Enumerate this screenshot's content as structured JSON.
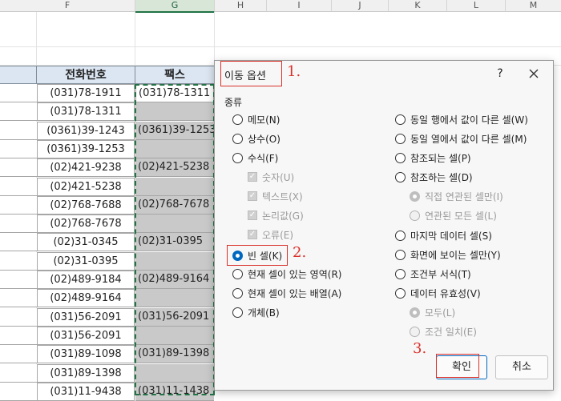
{
  "columns": [
    "F",
    "G",
    "H",
    "I",
    "J",
    "K",
    "L",
    "M"
  ],
  "sheet": {
    "header_phone": "전화번호",
    "header_fax": "팩스",
    "phones": [
      "(031)78-1911",
      "(031)78-1311",
      "(0361)39-1243",
      "(0361)39-1253",
      "(02)421-9238",
      "(02)421-5238",
      "(02)768-7688",
      "(02)768-7678",
      "(02)31-0345",
      "(02)31-0395",
      "(02)489-9184",
      "(02)489-9164",
      "(031)56-2091",
      "(031)56-2091",
      "(031)89-1098",
      "(031)89-1398",
      "(031)11-9438"
    ],
    "faxes": [
      "(031)78-1311",
      "",
      "(0361)39-1253",
      "",
      "(02)421-5238",
      "",
      "(02)768-7678",
      "",
      "(02)31-0395",
      "",
      "(02)489-9164",
      "",
      "(031)56-2091",
      "",
      "(031)89-1398",
      "",
      "(031)11-1438"
    ]
  },
  "dialog": {
    "title": "이동 옵션",
    "help": "?",
    "group_label": "종류",
    "left_options": [
      {
        "label": "메모(N)"
      },
      {
        "label": "상수(O)"
      },
      {
        "label": "수식(F)"
      },
      {
        "label": "숫자(U)"
      },
      {
        "label": "텍스트(X)"
      },
      {
        "label": "논리값(G)"
      },
      {
        "label": "오류(E)"
      },
      {
        "label": "빈 셀(K)",
        "checked": true
      },
      {
        "label": "현재 셀이 있는 영역(R)"
      },
      {
        "label": "현재 셀이 있는 배열(A)"
      },
      {
        "label": "개체(B)"
      }
    ],
    "right_options": [
      {
        "label": "동일 행에서 값이 다른 셀(W)"
      },
      {
        "label": "동일 열에서 값이 다른 셀(M)"
      },
      {
        "label": "참조되는 셀(P)"
      },
      {
        "label": "참조하는 셀(D)"
      },
      {
        "label": "직접 연관된 셀만(I)",
        "checked": true
      },
      {
        "label": "연관된 모든 셀(L)"
      },
      {
        "label": "마지막 데이터 셀(S)"
      },
      {
        "label": "화면에 보이는 셀만(Y)"
      },
      {
        "label": "조건부 서식(T)"
      },
      {
        "label": "데이터 유효성(V)"
      },
      {
        "label": "모두(L)",
        "checked": true
      },
      {
        "label": "조건 일치(E)"
      }
    ],
    "ok_label": "확인",
    "cancel_label": "취소"
  },
  "annotations": {
    "step1": "1.",
    "step2": "2.",
    "step3": "3.",
    "color": "#d9302a"
  },
  "colors": {
    "accent": "#0067c0",
    "selection": "#217346",
    "header_fill": "#dce6f2",
    "blank_fill": "#c9c9c9"
  }
}
